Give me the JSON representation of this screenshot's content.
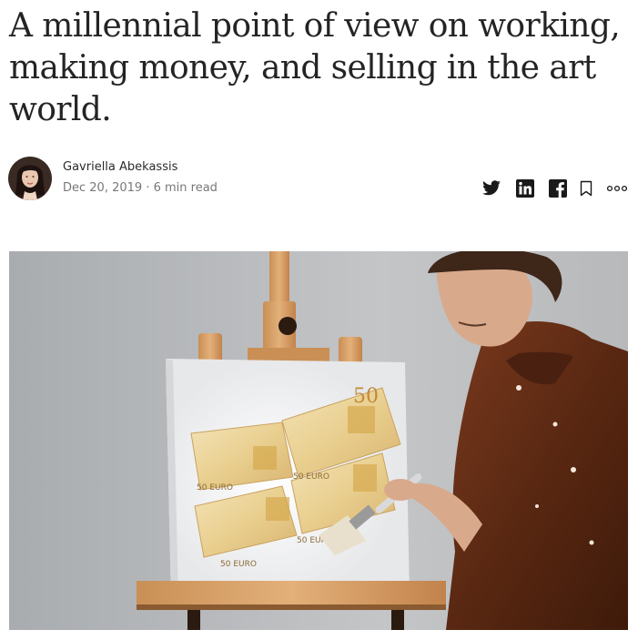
{
  "article": {
    "title": "A millennial point of view on working, making money, and selling in the art world."
  },
  "byline": {
    "author": "Gavriella Abekassis",
    "date": "Dec 20, 2019",
    "separator": "·",
    "read_time": "6 min read"
  },
  "share_actions": [
    {
      "icon": "twitter-icon"
    },
    {
      "icon": "linkedin-icon"
    },
    {
      "icon": "facebook-icon"
    },
    {
      "icon": "bookmark-icon"
    },
    {
      "icon": "more-options-icon"
    }
  ],
  "hero_image": {
    "banknote_labels": [
      "50",
      "50 EURO",
      "50 EURO",
      "50 EURO",
      "50 EURO"
    ]
  },
  "colors": {
    "text": "#292929",
    "meta_text": "#757575",
    "background": "#ffffff"
  }
}
